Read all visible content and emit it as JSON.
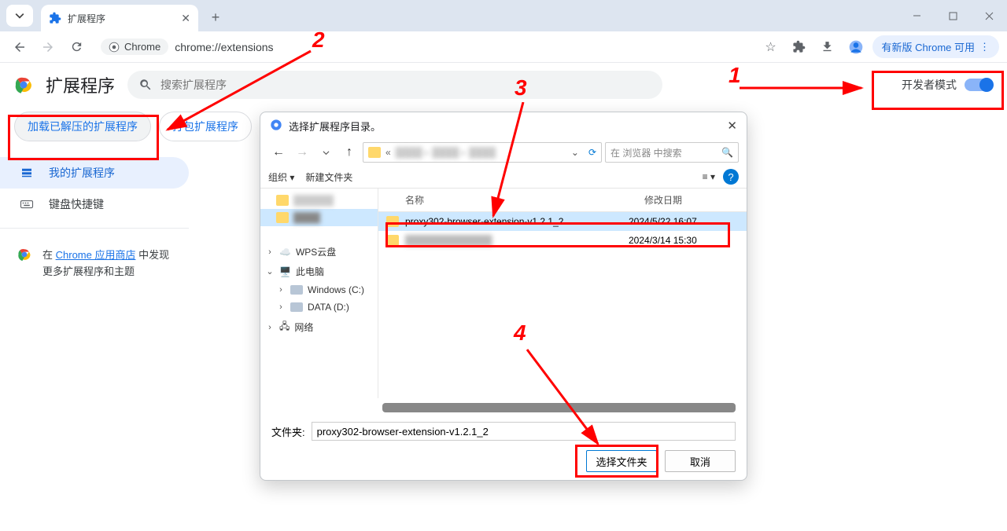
{
  "tab": {
    "title": "扩展程序"
  },
  "omnibox": {
    "securityChip": "Chrome",
    "url": "chrome://extensions",
    "updateChip": "有新版 Chrome 可用"
  },
  "extensions": {
    "title": "扩展程序",
    "searchPlaceholder": "搜索扩展程序",
    "devModeLabel": "开发者模式",
    "buttons": {
      "loadUnpacked": "加载已解压的扩展程序",
      "pack": "打包扩展程序"
    },
    "sidebar": {
      "myExtensions": "我的扩展程序",
      "shortcuts": "键盘快捷键",
      "storePrefix": "在 ",
      "storeLink": "Chrome 应用商店",
      "storeSuffix": " 中发现更多扩展程序和主题"
    }
  },
  "dialog": {
    "title": "选择扩展程序目录。",
    "back": "←",
    "forward": "→",
    "up": "↑",
    "refresh": "⟳",
    "pathPrefix": "«",
    "searchPlaceholder": "在 浏览器 中搜索",
    "organize": "组织",
    "newFolder": "新建文件夹",
    "view": "≡",
    "help": "?",
    "tree": {
      "wps": "WPS云盘",
      "thisPC": "此电脑",
      "windows": "Windows (C:)",
      "data": "DATA (D:)",
      "network": "网络"
    },
    "columns": {
      "name": "名称",
      "date": "修改日期"
    },
    "rows": [
      {
        "name": "proxy302-browser-extension-v1.2.1_2",
        "date": "2024/5/22 16:07",
        "selected": true
      },
      {
        "name": "",
        "date": "2024/3/14 15:30",
        "blurred": true
      }
    ],
    "folderLabel": "文件夹:",
    "folderValue": "proxy302-browser-extension-v1.2.1_2",
    "selectBtn": "选择文件夹",
    "cancelBtn": "取消"
  },
  "annotations": {
    "n1": "1",
    "n2": "2",
    "n3": "3",
    "n4": "4"
  }
}
